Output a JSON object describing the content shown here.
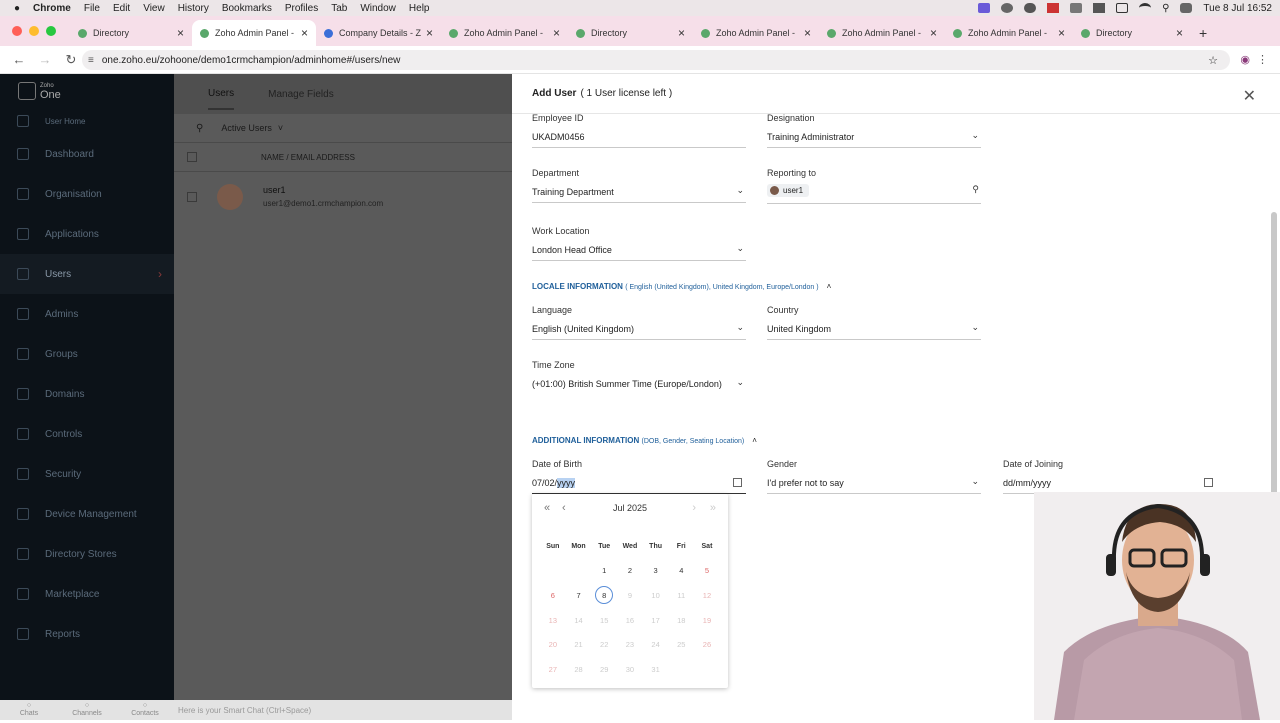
{
  "macbar": {
    "menus": [
      "Chrome",
      "File",
      "Edit",
      "View",
      "History",
      "Bookmarks",
      "Profiles",
      "Tab",
      "Window",
      "Help"
    ],
    "clock": "Tue 8 Jul  16:52"
  },
  "tabs": [
    {
      "title": "Directory",
      "active": false
    },
    {
      "title": "Zoho Admin Panel - ",
      "active": true
    },
    {
      "title": "Company Details - Z",
      "active": false
    },
    {
      "title": "Zoho Admin Panel - ",
      "active": false
    },
    {
      "title": "Directory",
      "active": false
    },
    {
      "title": "Zoho Admin Panel - ",
      "active": false
    },
    {
      "title": "Zoho Admin Panel - ",
      "active": false
    },
    {
      "title": "Zoho Admin Panel - ",
      "active": false
    },
    {
      "title": "Directory",
      "active": false
    }
  ],
  "address": {
    "url": "one.zoho.eu/zohoone/demo1crmchampion/adminhome#/users/new"
  },
  "sidebar": {
    "logo_small": "Zoho",
    "logo_big": "One",
    "home": "User Home",
    "items": [
      "Dashboard",
      "Organisation",
      "Applications",
      "Users",
      "Admins",
      "Groups",
      "Domains",
      "Controls",
      "Security",
      "Device Management",
      "Directory Stores",
      "Marketplace",
      "Reports"
    ]
  },
  "main": {
    "tab_users": "Users",
    "tab_fields": "Manage Fields",
    "filter": "Active Users",
    "col_header": "NAME / EMAIL ADDRESS",
    "user_name": "user1",
    "user_email": "user1@demo1.crmchampion.com"
  },
  "bottombar": {
    "chats": "Chats",
    "channels": "Channels",
    "contacts": "Contacts",
    "smart": "Here is your Smart Chat (Ctrl+Space)"
  },
  "panel": {
    "title": "Add User",
    "license": "( 1 User license left )",
    "employee_id_label": "Employee ID",
    "employee_id": "UKADM0456",
    "designation_label": "Designation",
    "designation": "Training Administrator",
    "department_label": "Department",
    "department": "Training Department",
    "reporting_label": "Reporting to",
    "reporting": "user1",
    "work_location_label": "Work Location",
    "work_location": "London Head Office",
    "locale_title": "LOCALE INFORMATION",
    "locale_sub": "( English (United Kingdom), United Kingdom, Europe/London )",
    "language_label": "Language",
    "language": "English (United Kingdom)",
    "country_label": "Country",
    "country": "United Kingdom",
    "tz_label": "Time Zone",
    "tz": "(+01:00) British Summer Time (Europe/London)",
    "additional_title": "ADDITIONAL INFORMATION",
    "additional_sub": "(DOB, Gender, Seating Location)",
    "dob_label": "Date of Birth",
    "dob_prefix": "07/02/",
    "dob_selected": "yyyy",
    "gender_label": "Gender",
    "gender": "I'd prefer not to say",
    "doj_label": "Date of Joining",
    "doj_placeholder": "dd/mm/yyyy"
  },
  "calendar": {
    "month": "Jul 2025",
    "dow": [
      "Sun",
      "Mon",
      "Tue",
      "Wed",
      "Thu",
      "Fri",
      "Sat"
    ],
    "weeks": [
      [
        "",
        "",
        "1",
        "2",
        "3",
        "4",
        "5"
      ],
      [
        "6",
        "7",
        "8",
        "9",
        "10",
        "11",
        "12"
      ],
      [
        "13",
        "14",
        "15",
        "16",
        "17",
        "18",
        "19"
      ],
      [
        "20",
        "21",
        "22",
        "23",
        "24",
        "25",
        "26"
      ],
      [
        "27",
        "28",
        "29",
        "30",
        "31",
        "",
        ""
      ]
    ],
    "today": "8"
  }
}
